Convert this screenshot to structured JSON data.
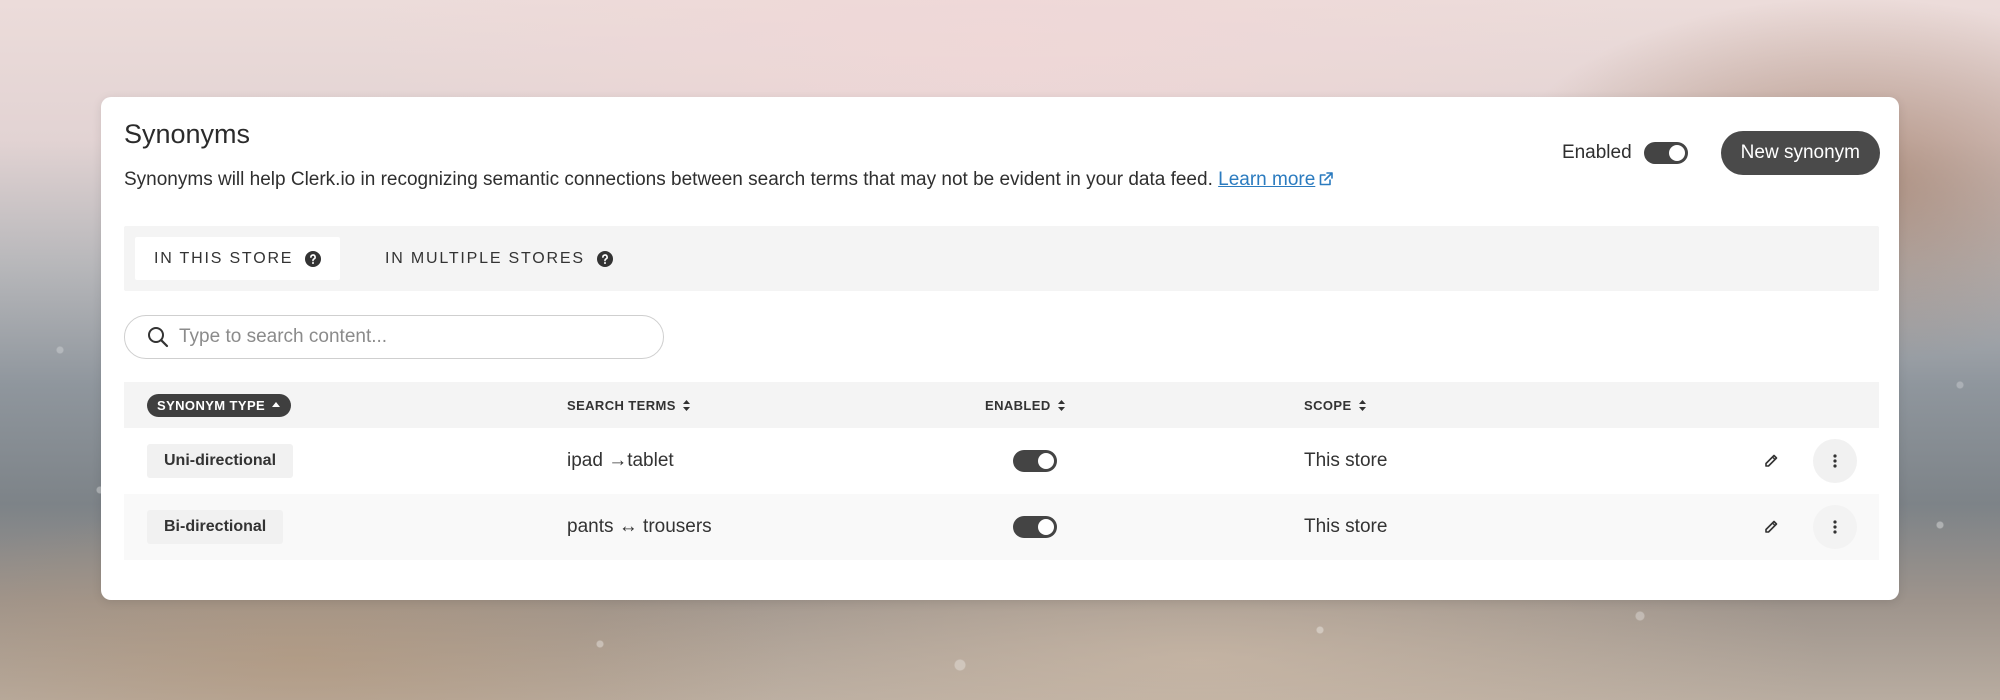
{
  "header": {
    "title": "Synonyms",
    "description": "Synonyms will help Clerk.io in recognizing semantic connections between search terms that may not be evident in your data feed.",
    "learn_more": "Learn more",
    "enabled_label": "Enabled",
    "enabled": true,
    "new_button": "New synonym"
  },
  "tabs": [
    {
      "label": "IN THIS STORE",
      "active": true
    },
    {
      "label": "IN MULTIPLE STORES",
      "active": false
    }
  ],
  "search": {
    "placeholder": "Type to search content...",
    "value": ""
  },
  "table": {
    "columns": [
      "SYNONYM TYPE",
      "SEARCH TERMS",
      "ENABLED",
      "SCOPE"
    ],
    "sorted_column": "SYNONYM TYPE",
    "rows": [
      {
        "type": "Uni-directional",
        "terms": "ipad →tablet",
        "enabled": true,
        "scope": "This store"
      },
      {
        "type": "Bi-directional",
        "terms": "pants ↔ trousers",
        "enabled": true,
        "scope": "This store"
      }
    ]
  },
  "colors": {
    "accent_dark": "#4a4a4a",
    "link": "#2b7bbf",
    "panel_gray": "#f4f4f4"
  },
  "icons": {
    "external_link": "external-link-icon",
    "help": "help-circle-icon",
    "search": "search-icon",
    "sort": "sort-icon",
    "sort_asc": "sort-asc-icon",
    "edit": "pencil-icon",
    "more": "more-vertical-icon"
  }
}
